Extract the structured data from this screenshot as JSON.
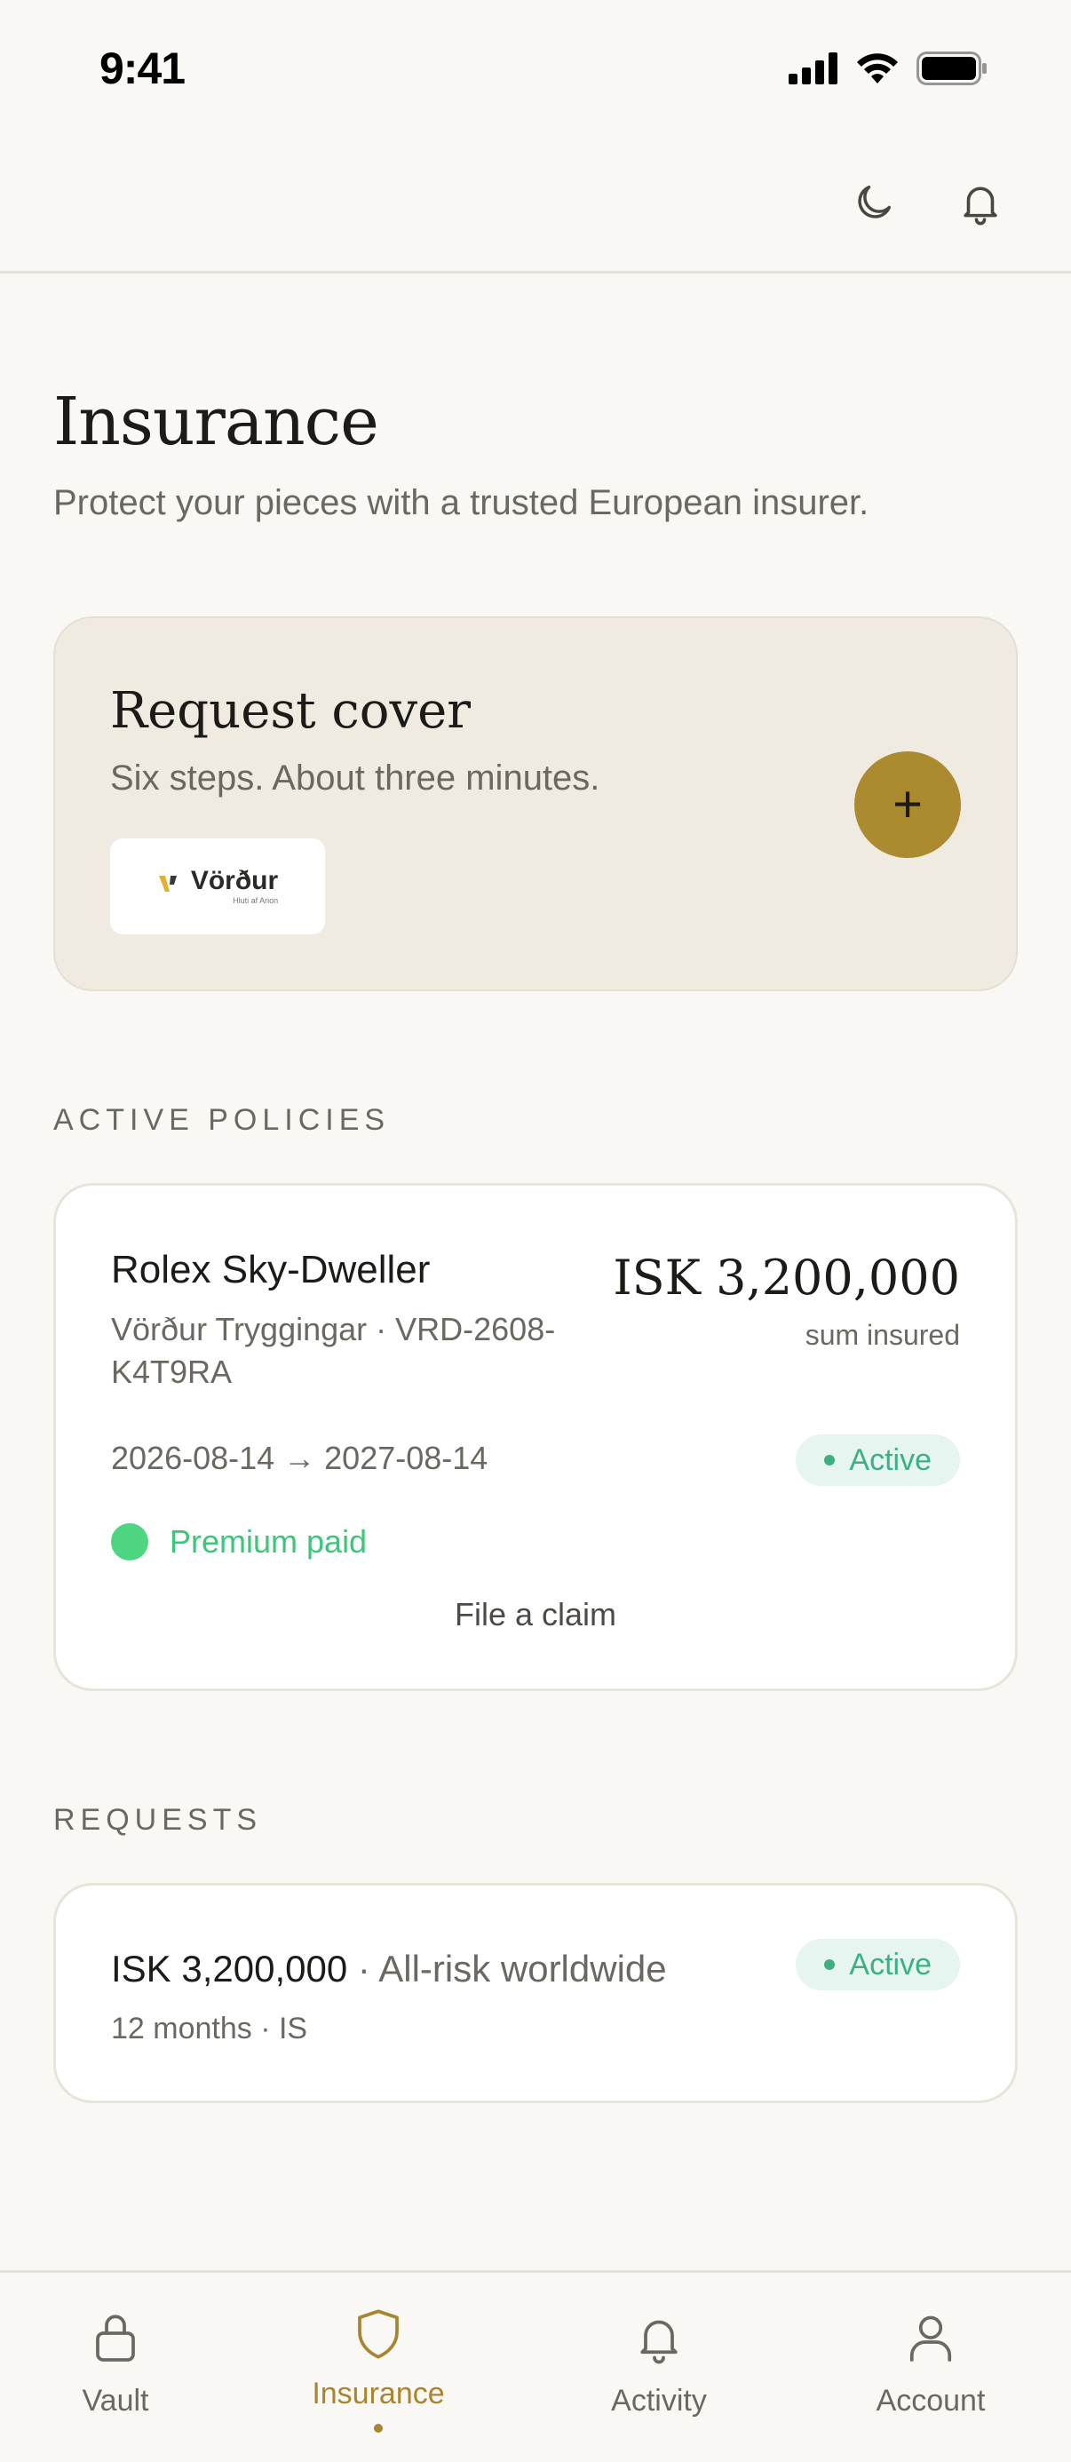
{
  "status_bar": {
    "time": "9:41"
  },
  "page": {
    "title": "Insurance",
    "subtitle": "Protect your pieces with a trusted European insurer."
  },
  "request_cover": {
    "title": "Request cover",
    "subtitle": "Six steps. About three minutes.",
    "insurer_logo_text": "Vörður",
    "insurer_logo_tagline": "Hluti af Arion",
    "add_label": "+"
  },
  "active_policies": {
    "label": "ACTIVE POLICIES",
    "items": [
      {
        "name": "Rolex Sky-Dweller",
        "insurer_ref": "Vörður Tryggingar · VRD-2608-K4T9RA",
        "amount": "ISK 3,200,000",
        "amount_label": "sum insured",
        "dates": "2026-08-14 → 2027-08-14",
        "status": "Active",
        "premium": "Premium paid",
        "claim_label": "File a claim"
      }
    ]
  },
  "requests": {
    "label": "REQUESTS",
    "items": [
      {
        "amount": "ISK 3,200,000",
        "coverage": " · All-risk worldwide",
        "details": "12 months · IS",
        "status": "Active"
      }
    ]
  },
  "tabs": [
    {
      "label": "Vault",
      "icon": "lock-icon",
      "active": false
    },
    {
      "label": "Insurance",
      "icon": "shield-icon",
      "active": true
    },
    {
      "label": "Activity",
      "icon": "bell-icon",
      "active": false
    },
    {
      "label": "Account",
      "icon": "user-icon",
      "active": false
    }
  ],
  "colors": {
    "background": "#f9f8f5",
    "accent": "#ac8a2f",
    "active_status": "#3cb083",
    "premium_paid": "#4ed582"
  }
}
